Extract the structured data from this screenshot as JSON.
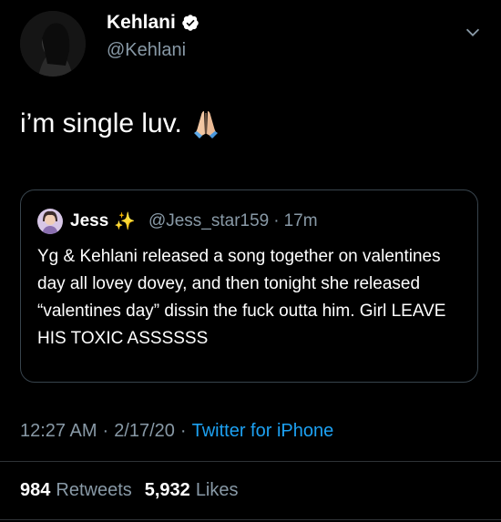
{
  "author": {
    "name": "Kehlani",
    "handle": "@Kehlani"
  },
  "tweet": {
    "text": "i’m single luv.",
    "emoji": "folded-hands-emoji"
  },
  "quote": {
    "name": "Jess",
    "emoji": "✨",
    "handle": "@Jess_star159",
    "time": "17m",
    "text": "Yg & Kehlani released a song together on valentines day all lovey dovey, and then tonight she released “valentines day” dissin the fuck outta him. Girl LEAVE HIS TOXIC ASSSSSS"
  },
  "meta": {
    "time": "12:27 AM",
    "date": "2/17/20",
    "source": "Twitter for iPhone"
  },
  "stats": {
    "retweets_count": "984",
    "retweets_label": "Retweets",
    "likes_count": "5,932",
    "likes_label": "Likes"
  },
  "colors": {
    "background": "#000000",
    "secondary_text": "#8899a6",
    "accent": "#1da1f2",
    "border": "#38444d"
  }
}
